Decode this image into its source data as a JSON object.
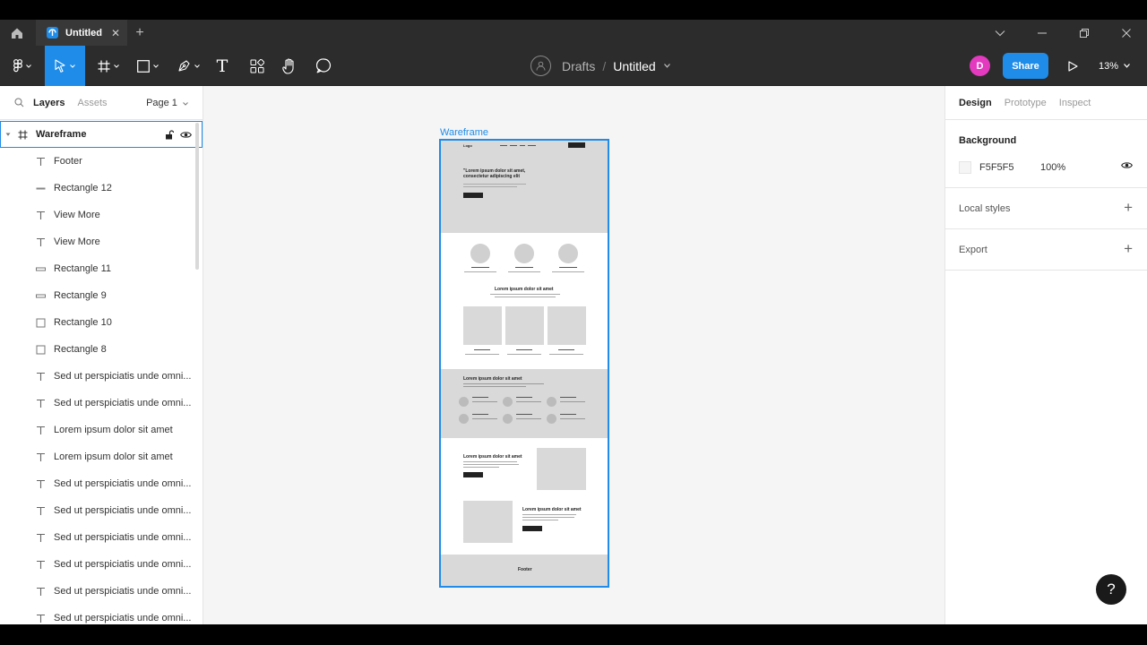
{
  "tabstrip": {
    "tab_title": "Untitled",
    "close_glyph": "✕",
    "new_tab_glyph": "+"
  },
  "toolbar": {
    "breadcrumb_parent": "Drafts",
    "breadcrumb_sep": "/",
    "file_name": "Untitled",
    "user_initial": "D",
    "share_label": "Share",
    "zoom_label": "13%",
    "text_tool_glyph": "T"
  },
  "left_panel": {
    "tab_layers": "Layers",
    "tab_assets": "Assets",
    "page_select": "Page 1",
    "frame_name": "Wareframe",
    "layers": [
      {
        "name": "Footer",
        "type": "text"
      },
      {
        "name": "Rectangle 12",
        "type": "line"
      },
      {
        "name": "View More",
        "type": "text"
      },
      {
        "name": "View More",
        "type": "text"
      },
      {
        "name": "Rectangle 11",
        "type": "rect-thin"
      },
      {
        "name": "Rectangle 9",
        "type": "rect-thin"
      },
      {
        "name": "Rectangle 10",
        "type": "rect"
      },
      {
        "name": "Rectangle 8",
        "type": "rect"
      },
      {
        "name": "Sed ut perspiciatis unde omni...",
        "type": "text"
      },
      {
        "name": "Sed ut perspiciatis unde omni...",
        "type": "text"
      },
      {
        "name": "Lorem ipsum dolor sit amet",
        "type": "text"
      },
      {
        "name": "Lorem ipsum dolor sit amet",
        "type": "text"
      },
      {
        "name": "Sed ut perspiciatis unde omni...",
        "type": "text"
      },
      {
        "name": "Sed ut perspiciatis unde omni...",
        "type": "text"
      },
      {
        "name": "Sed ut perspiciatis unde omni...",
        "type": "text"
      },
      {
        "name": "Sed ut perspiciatis unde omni...",
        "type": "text"
      },
      {
        "name": "Sed ut perspiciatis unde omni...",
        "type": "text"
      },
      {
        "name": "Sed ut perspiciatis unde omni...",
        "type": "text"
      }
    ]
  },
  "canvas": {
    "frame_label": "Wareframe",
    "wf": {
      "logo": "Logo",
      "hero_title_1": "\"Lorem ipsum dolor sit amet,",
      "hero_title_2": "consectetur adipiscing elit",
      "section_title": "Lorem ipsum dolor sit amet",
      "grey_title": "Lorem ipsum dolor sit amet",
      "split_title_1": "Lorem ipsum dolor sit amet",
      "split_title_2": "Lorem ipsum dolor sit amet",
      "footer": "Footer"
    }
  },
  "right_panel": {
    "tabs": [
      "Design",
      "Prototype",
      "Inspect"
    ],
    "background_title": "Background",
    "bg_hex": "F5F5F5",
    "bg_opacity": "100%",
    "local_styles": "Local styles",
    "export": "Export",
    "plus_glyph": "+"
  },
  "help": "?",
  "colors": {
    "accent": "#1e8ce8",
    "avatar": "#e33ac0",
    "chrome": "#2c2c2c",
    "canvas_bg": "#f5f5f5"
  }
}
